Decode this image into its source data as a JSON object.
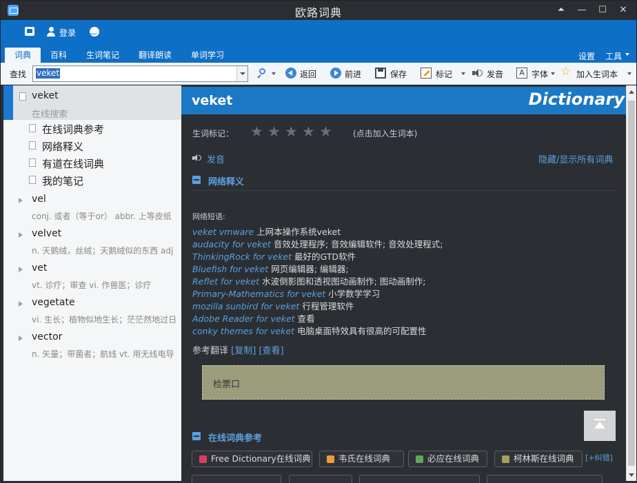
{
  "window": {
    "title": "欧路词典"
  },
  "header": {
    "login": "登录",
    "tabs": [
      "词典",
      "百科",
      "生词笔记",
      "翻译朗读",
      "单词学习"
    ],
    "settings": "设置",
    "tools": "工具"
  },
  "toolbar": {
    "search_label": "查找",
    "search_value": "veket",
    "back": "返回",
    "forward": "前进",
    "save": "保存",
    "mark": "标记",
    "pronounce": "发音",
    "font": "字体",
    "add_wordbook": "加入生词本"
  },
  "left": {
    "current": {
      "word": "veket",
      "sub": "在线搜索"
    },
    "subitems": [
      "在线词典参考",
      "网络释义",
      "有道在线词典",
      "我的笔记"
    ],
    "entries": [
      {
        "word": "vel",
        "def": "conj. 或者（等于or） abbr. 上等皮纸"
      },
      {
        "word": "velvet",
        "def": "n. 天鹅绒，丝绒；天鹅绒似的东西 adj"
      },
      {
        "word": "vet",
        "def": "vt. 诊疗；审查 vi. 作兽医；诊疗"
      },
      {
        "word": "vegetate",
        "def": "vi. 生长；植物似地生长；茫茫然地过日"
      },
      {
        "word": "vector",
        "def": "n. 矢量；带菌者；航线 vt. 用无线电导"
      }
    ]
  },
  "right": {
    "word": "veket",
    "brand": "Dictionary",
    "wordbook_mark_label": "生词标记：",
    "wordbook_hint": "(点击加入生词本)",
    "rating": 0,
    "pronounce": "发音",
    "toggle_all": "隐藏/显示所有词典",
    "section_web": "网络释义",
    "phrases_label": "网络短语:",
    "phrases": [
      {
        "en": "veket vmware",
        "zh": " 上网本操作系统veket"
      },
      {
        "en": "audacity for veket",
        "zh": " 音效处理程序; 音效编辑软件; 音效处理程式;"
      },
      {
        "en": "ThinkingRock for veket",
        "zh": " 最好的GTD软件"
      },
      {
        "en": "Bluefish for veket",
        "zh": " 网页编辑器; 编辑器;"
      },
      {
        "en": "Reflet for veket",
        "zh": " 水波倒影图和透视图动画制作; 图动画制作;"
      },
      {
        "en": "Primary-Mathematics for veket",
        "zh": " 小学数学学习"
      },
      {
        "en": "mozilla sunbird for veket",
        "zh": " 行程管理软件"
      },
      {
        "en": "Adobe Reader for veket",
        "zh": " 查看"
      },
      {
        "en": "conky themes for veket",
        "zh": " 电脑桌面特效具有很高的可配置性"
      }
    ],
    "ref_translation": "参考翻译",
    "copy": "[复制]",
    "view": "[查看]",
    "translation_text": "检票口",
    "section_online": "在线词典参考",
    "dicts": [
      {
        "name": "Free Dictionary在线词典",
        "color": "#d9405a"
      },
      {
        "name": "韦氏在线词典",
        "color": "#f09a3a"
      },
      {
        "name": "必应在线词典",
        "color": "#5fa85a"
      },
      {
        "name": "柯林斯在线词典",
        "color": "#a6a05a"
      }
    ],
    "report_error": "[+纠错]"
  }
}
